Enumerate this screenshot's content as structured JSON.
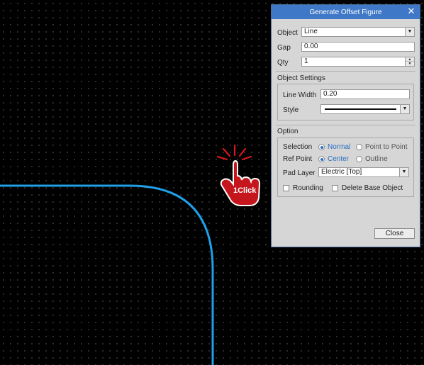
{
  "dialog": {
    "title": "Generate Offset Figure",
    "object": {
      "label": "Object",
      "value": "Line"
    },
    "gap": {
      "label": "Gap",
      "value": "0.00"
    },
    "qty": {
      "label": "Qty",
      "value": "1"
    },
    "object_settings": {
      "title": "Object Settings",
      "line_width": {
        "label": "Line Width",
        "value": "0.20"
      },
      "style": {
        "label": "Style"
      }
    },
    "option": {
      "title": "Option",
      "selection": {
        "label": "Selection",
        "options": [
          "Normal",
          "Point to Point"
        ],
        "selected": "Normal"
      },
      "ref_point": {
        "label": "Ref Point",
        "options": [
          "Center",
          "Outline"
        ],
        "selected": "Center"
      },
      "pad_layer": {
        "label": "Pad Layer",
        "value": "Electric [Top]"
      },
      "rounding": {
        "label": "Rounding",
        "checked": false
      },
      "delete_base": {
        "label": "Delete Base Object",
        "checked": false
      }
    },
    "close_button": "Close",
    "close_icon": "close-icon"
  },
  "canvas": {
    "curve_color": "#1fa0e8",
    "accent_color": "#3f78c6",
    "click_hint": "1Click",
    "click_hand_color": "#c4161c"
  }
}
